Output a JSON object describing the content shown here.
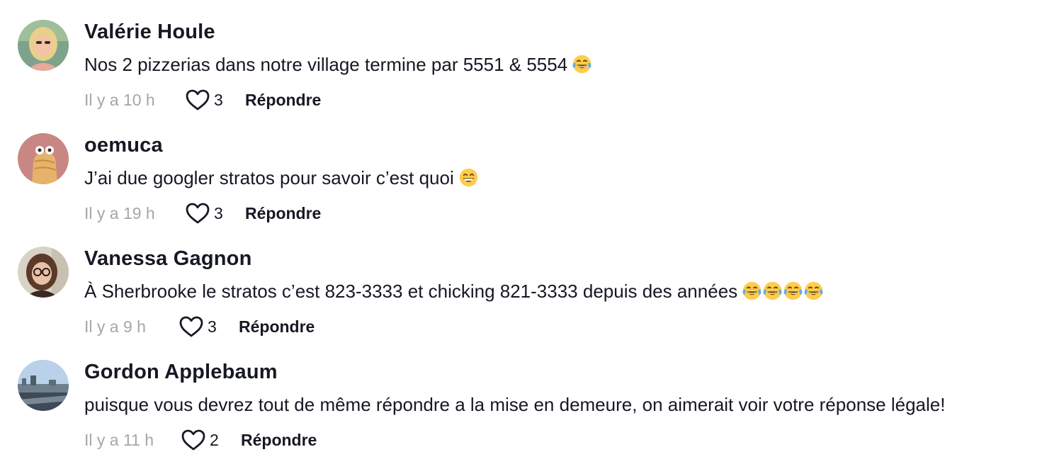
{
  "comments": [
    {
      "username": "Valérie Houle",
      "text": "Nos 2 pizzerias dans notre village termine par 5551 & 5554",
      "emoji_count": 1,
      "emoji": "face-with-tears-of-joy",
      "time": "Il y a 10 h",
      "likes": "3",
      "reply_label": "Répondre"
    },
    {
      "username": "oemuca",
      "text": "J’ai due googler stratos pour savoir c’est quoi",
      "emoji_count": 1,
      "emoji": "grinning-face-with-smiling-eyes",
      "time": "Il y a 19 h",
      "likes": "3",
      "reply_label": "Répondre"
    },
    {
      "username": "Vanessa Gagnon",
      "text": "À Sherbrooke le stratos c’est 823-3333 et chicking 821-3333 depuis des années",
      "emoji_count": 4,
      "emoji": "face-with-tears-of-joy",
      "time": "Il y a 9 h",
      "likes": "3",
      "reply_label": "Répondre"
    },
    {
      "username": "Gordon Applebaum",
      "text": "puisque vous devrez tout de même répondre a la mise en demeure, on aimerait voir votre réponse légale!",
      "emoji_count": 0,
      "emoji": "",
      "time": "Il y a 11 h",
      "likes": "2",
      "reply_label": "Répondre"
    }
  ],
  "icons": {
    "like": "heart-outline-icon"
  },
  "colors": {
    "text_primary": "#161823",
    "text_secondary": "#a5a6ab"
  }
}
